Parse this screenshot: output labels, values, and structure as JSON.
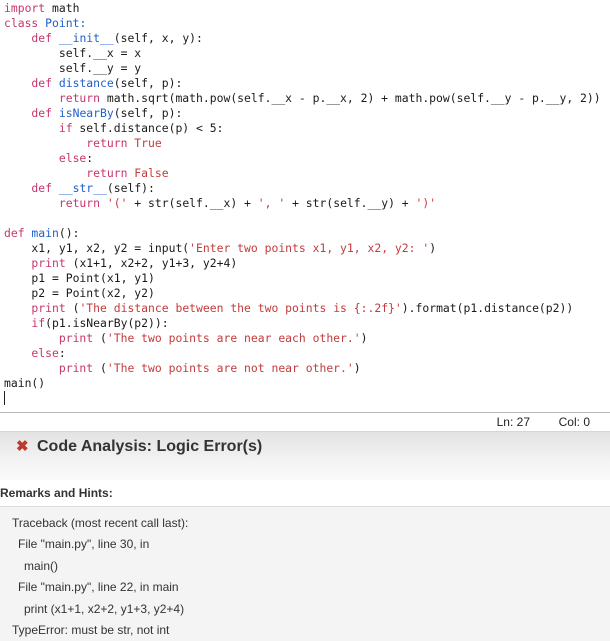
{
  "editor": {
    "lines": [
      [
        {
          "t": "import",
          "c": "kw"
        },
        {
          "t": " math",
          "c": "plain"
        }
      ],
      [
        {
          "t": "class",
          "c": "kw"
        },
        {
          "t": " Point:",
          "c": "def"
        }
      ],
      [
        {
          "t": "    def",
          "c": "kw"
        },
        {
          "t": " __init__",
          "c": "def"
        },
        {
          "t": "(self, x, y):",
          "c": "plain"
        }
      ],
      [
        {
          "t": "        self.__x = x",
          "c": "plain"
        }
      ],
      [
        {
          "t": "        self.__y = y",
          "c": "plain"
        }
      ],
      [
        {
          "t": "    def",
          "c": "kw"
        },
        {
          "t": " distance",
          "c": "def"
        },
        {
          "t": "(self, p):",
          "c": "plain"
        }
      ],
      [
        {
          "t": "        return",
          "c": "kw"
        },
        {
          "t": " math.sqrt(math.pow(self.__x - p.__x, 2) + math.pow(self.__y - p.__y, 2))",
          "c": "plain"
        }
      ],
      [
        {
          "t": "    def",
          "c": "kw"
        },
        {
          "t": " isNearBy",
          "c": "def"
        },
        {
          "t": "(self, p):",
          "c": "plain"
        }
      ],
      [
        {
          "t": "        if",
          "c": "kw"
        },
        {
          "t": " self.distance(p) < 5:",
          "c": "plain"
        }
      ],
      [
        {
          "t": "            return",
          "c": "kw"
        },
        {
          "t": " True",
          "c": "str"
        }
      ],
      [
        {
          "t": "        else",
          "c": "kw"
        },
        {
          "t": ":",
          "c": "plain"
        }
      ],
      [
        {
          "t": "            return",
          "c": "kw"
        },
        {
          "t": " False",
          "c": "str"
        }
      ],
      [
        {
          "t": "    def",
          "c": "kw"
        },
        {
          "t": " __str__",
          "c": "def"
        },
        {
          "t": "(self):",
          "c": "plain"
        }
      ],
      [
        {
          "t": "        return",
          "c": "kw"
        },
        {
          "t": " '('",
          "c": "str"
        },
        {
          "t": " + str(self.__x) + ",
          "c": "plain"
        },
        {
          "t": "', '",
          "c": "str"
        },
        {
          "t": " + str(self.__y) + ",
          "c": "plain"
        },
        {
          "t": "')'",
          "c": "str"
        }
      ],
      [],
      [
        {
          "t": "def",
          "c": "kw"
        },
        {
          "t": " main",
          "c": "def"
        },
        {
          "t": "():",
          "c": "plain"
        }
      ],
      [
        {
          "t": "    x1, y1, x2, y2 = input(",
          "c": "plain"
        },
        {
          "t": "'Enter two points x1, y1, x2, y2: '",
          "c": "str"
        },
        {
          "t": ")",
          "c": "plain"
        }
      ],
      [
        {
          "t": "    print",
          "c": "kw"
        },
        {
          "t": " (x1+1, x2+2, y1+3, y2+4)",
          "c": "plain"
        }
      ],
      [
        {
          "t": "    p1 = Point(x1, y1)",
          "c": "plain"
        }
      ],
      [
        {
          "t": "    p2 = Point(x2, y2)",
          "c": "plain"
        }
      ],
      [
        {
          "t": "    print",
          "c": "kw"
        },
        {
          "t": " (",
          "c": "plain"
        },
        {
          "t": "'The distance between the two points is {:.2f}'",
          "c": "str"
        },
        {
          "t": ").format(p1.distance(p2))",
          "c": "plain"
        }
      ],
      [
        {
          "t": "    if",
          "c": "kw"
        },
        {
          "t": "(p1.isNearBy(p2)):",
          "c": "plain"
        }
      ],
      [
        {
          "t": "        print",
          "c": "kw"
        },
        {
          "t": " (",
          "c": "plain"
        },
        {
          "t": "'The two points are near each other.'",
          "c": "str"
        },
        {
          "t": ")",
          "c": "plain"
        }
      ],
      [
        {
          "t": "    else",
          "c": "kw"
        },
        {
          "t": ":",
          "c": "plain"
        }
      ],
      [
        {
          "t": "        print",
          "c": "kw"
        },
        {
          "t": " (",
          "c": "plain"
        },
        {
          "t": "'The two points are not near other.'",
          "c": "str"
        },
        {
          "t": ")",
          "c": "plain"
        }
      ],
      [
        {
          "t": "main()",
          "c": "plain"
        }
      ]
    ]
  },
  "statusbar": {
    "ln": "Ln: 27",
    "col": "Col: 0"
  },
  "analysis": {
    "icon": "x-error-icon",
    "title": "Code Analysis: Logic Error(s)",
    "remarks_title": "Remarks and Hints:",
    "traceback": [
      "Traceback (most recent call last):",
      "File \"main.py\", line 30, in",
      "main()",
      "File \"main.py\", line 22, in main",
      "print (x1+1, x2+2, y1+3, y2+4)",
      "TypeError: must be str, not int"
    ]
  },
  "colors": {
    "keyword": "#c8356e",
    "string": "#c53b3b",
    "definition": "#1f5fcc",
    "error": "#c0392b"
  }
}
